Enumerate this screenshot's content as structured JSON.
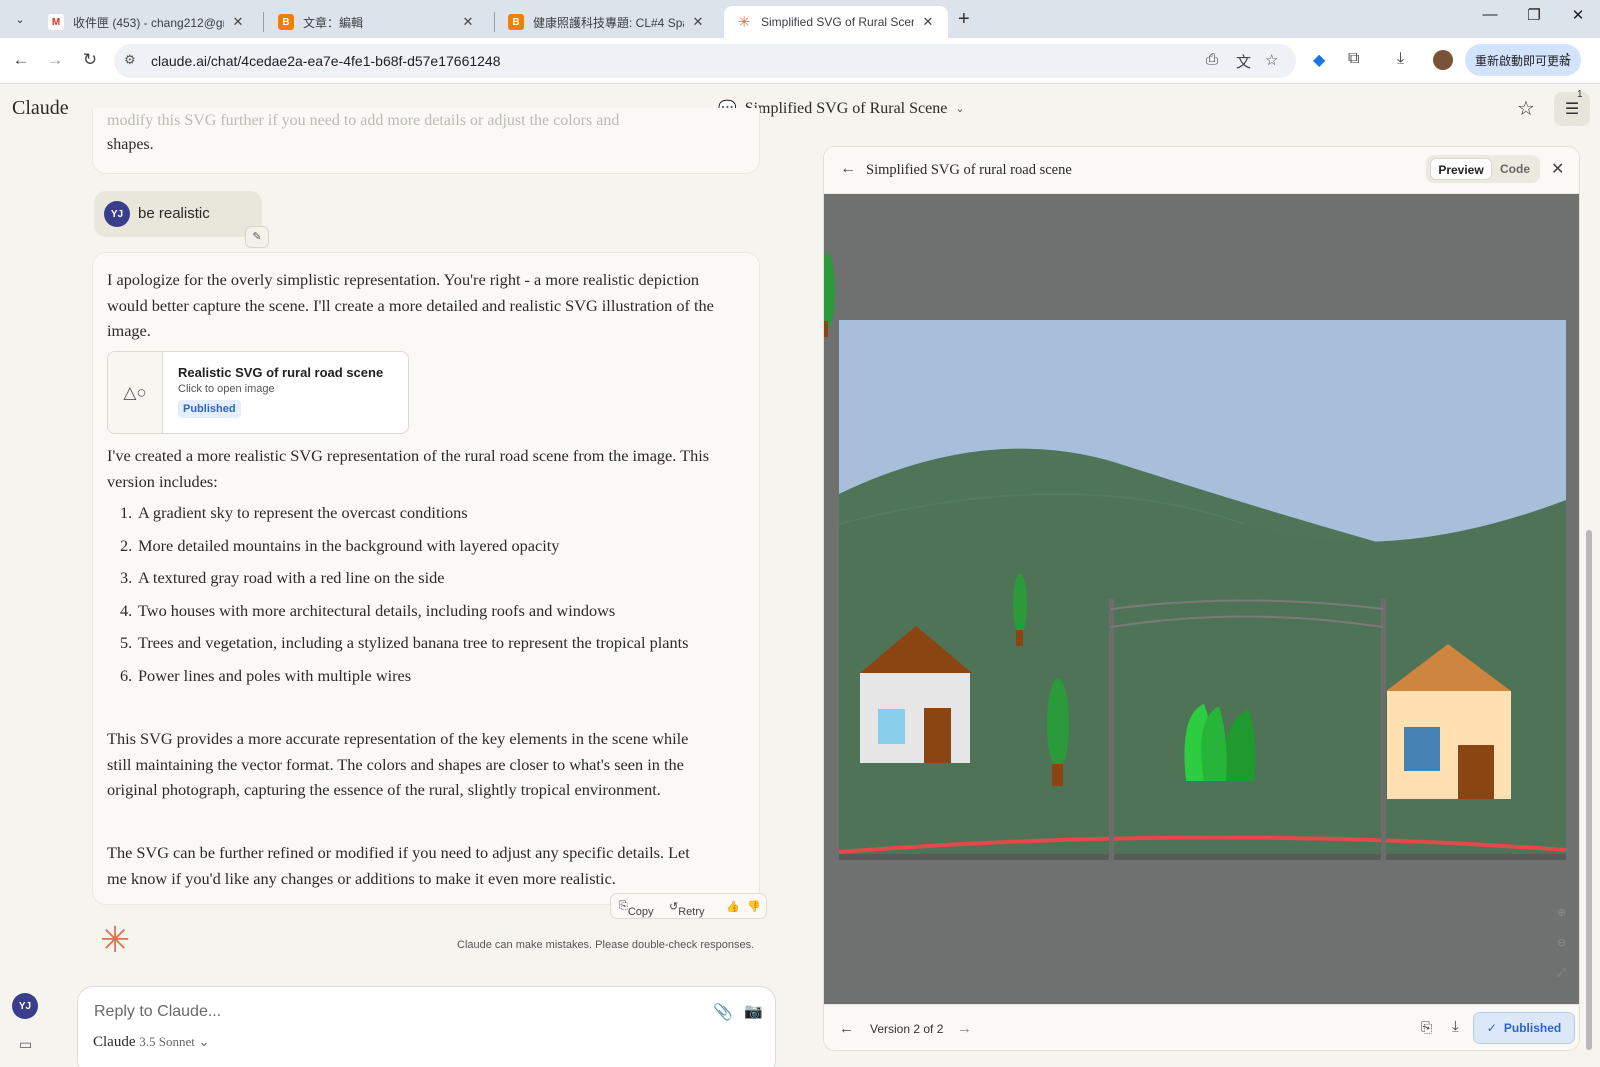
{
  "browser": {
    "tabs": [
      {
        "title": "收件匣 (453) - chang212@gm",
        "favicon": "gmail-icon",
        "active": false
      },
      {
        "title": "文章：編輯",
        "favicon": "blogger-icon",
        "active": false
      },
      {
        "title": "健康照護科技專題: CL#4 Space",
        "favicon": "blogger-icon",
        "active": false
      },
      {
        "title": "Simplified SVG of Rural Scene",
        "favicon": "claude-icon",
        "active": true
      }
    ],
    "url": "claude.ai/chat/4cedae2a-ea7e-4fe1-b68f-d57e17661248",
    "update_label": "重新啟動即可更新"
  },
  "app": {
    "brand": "Claude",
    "chat_title": "Simplified SVG of Rural Scene",
    "settings_badge": "1"
  },
  "chat": {
    "prev_fade": "modify this SVG further if you need to add more details or adjust the colors and",
    "prev_tail": "shapes.",
    "user_avatar": "YJ",
    "user_message": "be realistic",
    "reply": {
      "para1": "I apologize for the overly simplistic representation. You're right - a more realistic depiction would better capture the scene. I'll create a more detailed and realistic SVG illustration of the image.",
      "artifact": {
        "title": "Realistic SVG of rural road scene",
        "subtitle": "Click to open image",
        "badge": "Published"
      },
      "para2": "I've created a more realistic SVG representation of the rural road scene from the image. This version includes:",
      "list": [
        {
          "num": "1.",
          "text": "A gradient sky to represent the overcast conditions"
        },
        {
          "num": "2.",
          "text": "More detailed mountains in the background with layered opacity"
        },
        {
          "num": "3.",
          "text": "A textured gray road with a red line on the side"
        },
        {
          "num": "4.",
          "text": "Two houses with more architectural details, including roofs and windows"
        },
        {
          "num": "5.",
          "text": "Trees and vegetation, including a stylized banana tree to represent the tropical plants"
        },
        {
          "num": "6.",
          "text": "Power lines and poles with multiple wires"
        }
      ],
      "para3": "This SVG provides a more accurate representation of the key elements in the scene while still maintaining the vector format. The colors and shapes are closer to what's seen in the original photograph, capturing the essence of the rural, slightly tropical environment.",
      "para4": "The SVG can be further refined or modified if you need to adjust any specific details. Let me know if you'd like any changes or additions to make it even more realistic."
    },
    "actions": {
      "copy": "Copy",
      "retry": "Retry"
    },
    "disclaimer": "Claude can make mistakes. Please double-check responses.",
    "input_placeholder": "Reply to Claude...",
    "model_name": "Claude",
    "model_version": "3.5 Sonnet"
  },
  "artifact_panel": {
    "title": "Simplified SVG of rural road scene",
    "tab_preview": "Preview",
    "tab_code": "Code",
    "version_label": "Version 2 of 2",
    "published_label": "Published"
  },
  "colors": {
    "sky": "#a8bfdc",
    "hill_dark": "#4e7558",
    "hill_light": "#5a7a60",
    "road_line": "#e5484a",
    "canvas_bg": "#6f7170",
    "roof_left": "#8b4513",
    "roof_right": "#cd853f",
    "house_left_wall": "#e6e6e6",
    "house_right_wall": "#ffe0b0",
    "window_left": "#87ceeb",
    "window_right": "#4682b4",
    "door": "#8b4513",
    "accent_blue": "#2b66c2"
  }
}
